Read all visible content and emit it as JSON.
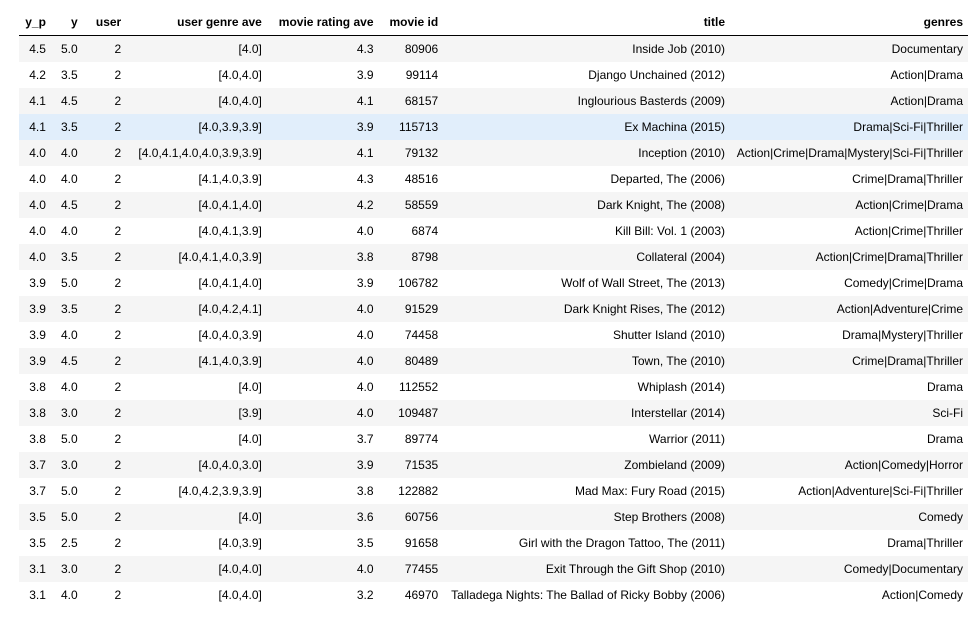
{
  "table": {
    "headers": [
      "y_p",
      "y",
      "user",
      "user genre ave",
      "movie rating ave",
      "movie id",
      "title",
      "genres"
    ],
    "highlighted_row": 3,
    "rows": [
      [
        "4.5",
        "5.0",
        "2",
        "[4.0]",
        "4.3",
        "80906",
        "Inside Job (2010)",
        "Documentary"
      ],
      [
        "4.2",
        "3.5",
        "2",
        "[4.0,4.0]",
        "3.9",
        "99114",
        "Django Unchained (2012)",
        "Action|Drama"
      ],
      [
        "4.1",
        "4.5",
        "2",
        "[4.0,4.0]",
        "4.1",
        "68157",
        "Inglourious Basterds (2009)",
        "Action|Drama"
      ],
      [
        "4.1",
        "3.5",
        "2",
        "[4.0,3.9,3.9]",
        "3.9",
        "115713",
        "Ex Machina (2015)",
        "Drama|Sci-Fi|Thriller"
      ],
      [
        "4.0",
        "4.0",
        "2",
        "[4.0,4.1,4.0,4.0,3.9,3.9]",
        "4.1",
        "79132",
        "Inception (2010)",
        "Action|Crime|Drama|Mystery|Sci-Fi|Thriller"
      ],
      [
        "4.0",
        "4.0",
        "2",
        "[4.1,4.0,3.9]",
        "4.3",
        "48516",
        "Departed, The (2006)",
        "Crime|Drama|Thriller"
      ],
      [
        "4.0",
        "4.5",
        "2",
        "[4.0,4.1,4.0]",
        "4.2",
        "58559",
        "Dark Knight, The (2008)",
        "Action|Crime|Drama"
      ],
      [
        "4.0",
        "4.0",
        "2",
        "[4.0,4.1,3.9]",
        "4.0",
        "6874",
        "Kill Bill: Vol. 1 (2003)",
        "Action|Crime|Thriller"
      ],
      [
        "4.0",
        "3.5",
        "2",
        "[4.0,4.1,4.0,3.9]",
        "3.8",
        "8798",
        "Collateral (2004)",
        "Action|Crime|Drama|Thriller"
      ],
      [
        "3.9",
        "5.0",
        "2",
        "[4.0,4.1,4.0]",
        "3.9",
        "106782",
        "Wolf of Wall Street, The (2013)",
        "Comedy|Crime|Drama"
      ],
      [
        "3.9",
        "3.5",
        "2",
        "[4.0,4.2,4.1]",
        "4.0",
        "91529",
        "Dark Knight Rises, The (2012)",
        "Action|Adventure|Crime"
      ],
      [
        "3.9",
        "4.0",
        "2",
        "[4.0,4.0,3.9]",
        "4.0",
        "74458",
        "Shutter Island (2010)",
        "Drama|Mystery|Thriller"
      ],
      [
        "3.9",
        "4.5",
        "2",
        "[4.1,4.0,3.9]",
        "4.0",
        "80489",
        "Town, The (2010)",
        "Crime|Drama|Thriller"
      ],
      [
        "3.8",
        "4.0",
        "2",
        "[4.0]",
        "4.0",
        "112552",
        "Whiplash (2014)",
        "Drama"
      ],
      [
        "3.8",
        "3.0",
        "2",
        "[3.9]",
        "4.0",
        "109487",
        "Interstellar (2014)",
        "Sci-Fi"
      ],
      [
        "3.8",
        "5.0",
        "2",
        "[4.0]",
        "3.7",
        "89774",
        "Warrior (2011)",
        "Drama"
      ],
      [
        "3.7",
        "3.0",
        "2",
        "[4.0,4.0,3.0]",
        "3.9",
        "71535",
        "Zombieland (2009)",
        "Action|Comedy|Horror"
      ],
      [
        "3.7",
        "5.0",
        "2",
        "[4.0,4.2,3.9,3.9]",
        "3.8",
        "122882",
        "Mad Max: Fury Road (2015)",
        "Action|Adventure|Sci-Fi|Thriller"
      ],
      [
        "3.5",
        "5.0",
        "2",
        "[4.0]",
        "3.6",
        "60756",
        "Step Brothers (2008)",
        "Comedy"
      ],
      [
        "3.5",
        "2.5",
        "2",
        "[4.0,3.9]",
        "3.5",
        "91658",
        "Girl with the Dragon Tattoo, The (2011)",
        "Drama|Thriller"
      ],
      [
        "3.1",
        "3.0",
        "2",
        "[4.0,4.0]",
        "4.0",
        "77455",
        "Exit Through the Gift Shop (2010)",
        "Comedy|Documentary"
      ],
      [
        "3.1",
        "4.0",
        "2",
        "[4.0,4.0]",
        "3.2",
        "46970",
        "Talladega Nights: The Ballad of Ricky Bobby (2006)",
        "Action|Comedy"
      ]
    ]
  }
}
